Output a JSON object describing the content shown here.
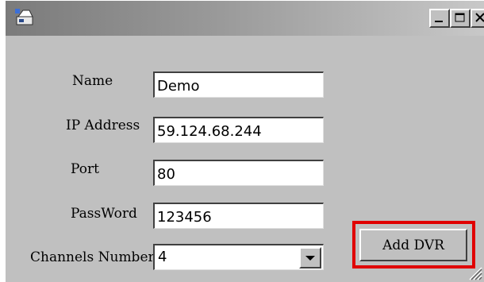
{
  "window": {
    "title": "",
    "controls": {
      "minimize": "minimize",
      "maximize": "maximize",
      "close": "close"
    }
  },
  "form": {
    "name": {
      "label": "Name",
      "value": "Demo"
    },
    "ip": {
      "label": "IP Address",
      "value": "59.124.68.244"
    },
    "port": {
      "label": "Port",
      "value": "80"
    },
    "password": {
      "label": "PassWord",
      "value": "123456"
    },
    "channels": {
      "label": "Channels Number",
      "value": "4"
    }
  },
  "buttons": {
    "add_dvr": "Add DVR"
  },
  "icons": [
    "app-icon",
    "minimize-icon",
    "maximize-icon",
    "close-icon",
    "chevron-down-icon",
    "resize-grip-icon"
  ],
  "colors": {
    "window_bg": "#c0c0c0",
    "highlight": "#e00000"
  }
}
